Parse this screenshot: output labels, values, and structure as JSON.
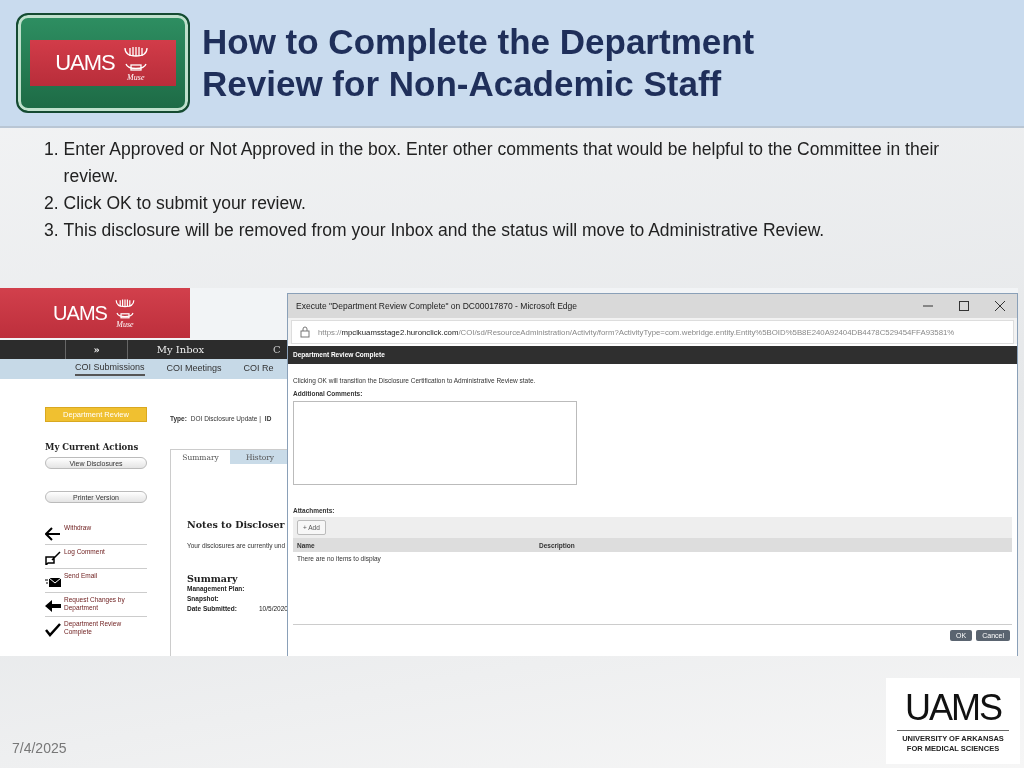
{
  "slide": {
    "logo": {
      "wordmark": "UAMS",
      "subtext": "Muse"
    },
    "title": "How to Complete the Department Review for Non-Academic Staff",
    "steps": [
      {
        "number": "1.",
        "text": "Enter Approved or Not Approved in the box. Enter other comments that would be helpful to the Committee in their review."
      },
      {
        "number": "2.",
        "text": "Click OK to submit your review."
      },
      {
        "number": "3.",
        "text": "This disclosure will be removed from your Inbox and the status will move to Administrative Review."
      }
    ],
    "date": "7/4/2025",
    "footer_logo": {
      "wordmark": "UAMS",
      "lines": [
        "UNIVERSITY OF ARKANSAS",
        "FOR MEDICAL SCIENCES"
      ]
    }
  },
  "app": {
    "logo": {
      "wordmark": "UAMS",
      "subtext": "Muse"
    },
    "nav": [
      {
        "label": "»"
      },
      {
        "label": "My Inbox"
      },
      {
        "label": "C"
      }
    ],
    "subnav": [
      {
        "label": "COI Submissions",
        "selected": true
      },
      {
        "label": "COI Meetings",
        "selected": false
      },
      {
        "label": "COI Re",
        "selected": false
      }
    ],
    "status": "Department Review",
    "type_label": "Type:",
    "type_value": "DOI Disclosure Update  |",
    "id_label": "ID",
    "actions_heading": "My Current Actions",
    "buttons": [
      "View Disclosures",
      "Printer Version"
    ],
    "activities": [
      {
        "kind": "back",
        "label": "Withdraw"
      },
      {
        "kind": "comment",
        "label": "Log Comment"
      },
      {
        "kind": "email",
        "label": "Send Email"
      },
      {
        "kind": "request",
        "label": "Request Changes by Department"
      },
      {
        "kind": "complete",
        "label": "Department Review Complete"
      }
    ],
    "tabs": [
      {
        "label": "Summary",
        "selected": true
      },
      {
        "label": "History",
        "selected": false
      }
    ],
    "notes_heading": "Notes to Discloser",
    "notes_text": "Your disclosures are currently und",
    "summary_heading": "Summary",
    "fields": [
      {
        "label": "Management Plan:"
      },
      {
        "label": "Snapshot:"
      },
      {
        "label": "Date Submitted:",
        "value": "10/5/2020"
      }
    ]
  },
  "dialog": {
    "title": "Execute \"Department Review Complete\" on DC00017870 - Microsoft Edge",
    "url": "https://**mpclkuamsstage2.huronclick.com**/COI/sd/ResourceAdministration/Activity/form?ActivityType=com.webridge.entity.Entity%5BOID%5B8E240A92404DB4478C529454FFA93581%",
    "header": "Department Review Complete",
    "message": "Clicking OK will transition the Disclosure Certification to Administrative Review state.",
    "comments_label": "Additional Comments:",
    "attachments_label": "Attachments:",
    "add_button": "+ Add",
    "columns": [
      "Name",
      "Description"
    ],
    "empty_text": "There are no items to display",
    "buttons": [
      "OK",
      "Cancel"
    ]
  }
}
